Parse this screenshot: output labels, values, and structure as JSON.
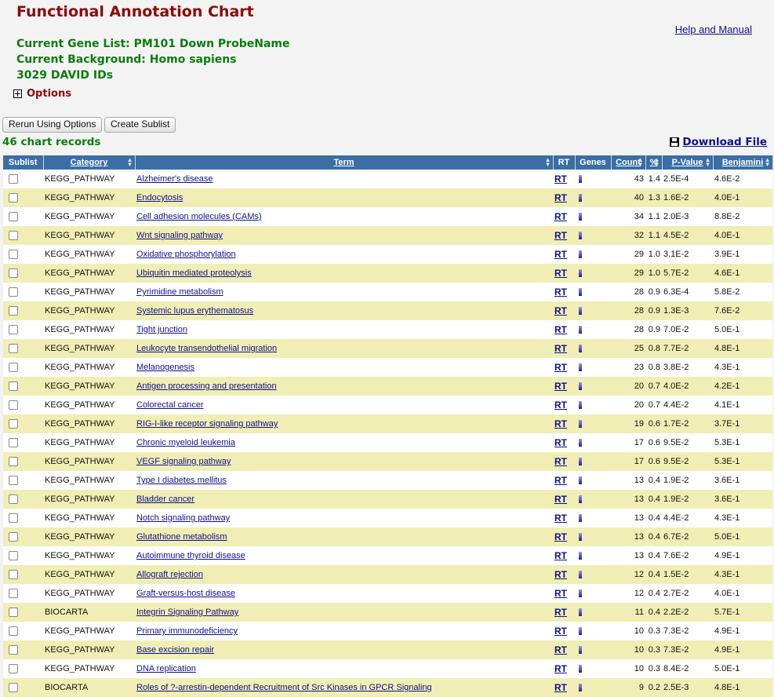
{
  "page": {
    "title": "Functional Annotation Chart",
    "help_link": "Help and Manual",
    "gene_list": "Current Gene List: PM101 Down ProbeName",
    "background": "Current Background: Homo sapiens",
    "david_ids": "3029 DAVID IDs",
    "options_label": "Options",
    "rerun_button": "Rerun Using Options",
    "sublist_button": "Create Sublist",
    "record_count": "46 chart records",
    "download_label": "Download File"
  },
  "table": {
    "headers": {
      "sublist": "Sublist",
      "category": "Category",
      "term": "Term",
      "rt": "RT",
      "genes": "Genes",
      "count": "Count",
      "percent": "%",
      "pvalue": "P-Value",
      "benjamini": "Benjamini"
    },
    "rows": [
      {
        "category": "KEGG_PATHWAY",
        "term": "Alzheimer's disease",
        "rt": "RT",
        "count": "43",
        "percent": "1.4",
        "pvalue": "2.5E-4",
        "benjamini": "4.6E-2"
      },
      {
        "category": "KEGG_PATHWAY",
        "term": "Endocytosis",
        "rt": "RT",
        "count": "40",
        "percent": "1.3",
        "pvalue": "1.6E-2",
        "benjamini": "4.0E-1"
      },
      {
        "category": "KEGG_PATHWAY",
        "term": "Cell adhesion molecules (CAMs)",
        "rt": "RT",
        "count": "34",
        "percent": "1.1",
        "pvalue": "2.0E-3",
        "benjamini": "8.8E-2"
      },
      {
        "category": "KEGG_PATHWAY",
        "term": "Wnt signaling pathway",
        "rt": "RT",
        "count": "32",
        "percent": "1.1",
        "pvalue": "4.5E-2",
        "benjamini": "4.0E-1"
      },
      {
        "category": "KEGG_PATHWAY",
        "term": "Oxidative phosphorylation",
        "rt": "RT",
        "count": "29",
        "percent": "1.0",
        "pvalue": "3.1E-2",
        "benjamini": "3.9E-1"
      },
      {
        "category": "KEGG_PATHWAY",
        "term": "Ubiquitin mediated proteolysis",
        "rt": "RT",
        "count": "29",
        "percent": "1.0",
        "pvalue": "5.7E-2",
        "benjamini": "4.6E-1"
      },
      {
        "category": "KEGG_PATHWAY",
        "term": "Pyrimidine metabolism",
        "rt": "RT",
        "count": "28",
        "percent": "0.9",
        "pvalue": "6.3E-4",
        "benjamini": "5.8E-2"
      },
      {
        "category": "KEGG_PATHWAY",
        "term": "Systemic lupus erythematosus",
        "rt": "RT",
        "count": "28",
        "percent": "0.9",
        "pvalue": "1.3E-3",
        "benjamini": "7.6E-2"
      },
      {
        "category": "KEGG_PATHWAY",
        "term": "Tight junction",
        "rt": "RT",
        "count": "28",
        "percent": "0.9",
        "pvalue": "7.0E-2",
        "benjamini": "5.0E-1"
      },
      {
        "category": "KEGG_PATHWAY",
        "term": "Leukocyte transendothelial migration",
        "rt": "RT",
        "count": "25",
        "percent": "0.8",
        "pvalue": "7.7E-2",
        "benjamini": "4.8E-1"
      },
      {
        "category": "KEGG_PATHWAY",
        "term": "Melanogenesis",
        "rt": "RT",
        "count": "23",
        "percent": "0.8",
        "pvalue": "3.8E-2",
        "benjamini": "4.3E-1"
      },
      {
        "category": "KEGG_PATHWAY",
        "term": "Antigen processing and presentation",
        "rt": "RT",
        "count": "20",
        "percent": "0.7",
        "pvalue": "4.0E-2",
        "benjamini": "4.2E-1"
      },
      {
        "category": "KEGG_PATHWAY",
        "term": "Colorectal cancer",
        "rt": "RT",
        "count": "20",
        "percent": "0.7",
        "pvalue": "4.4E-2",
        "benjamini": "4.1E-1"
      },
      {
        "category": "KEGG_PATHWAY",
        "term": "RIG-I-like receptor signaling pathway",
        "rt": "RT",
        "count": "19",
        "percent": "0.6",
        "pvalue": "1.7E-2",
        "benjamini": "3.7E-1"
      },
      {
        "category": "KEGG_PATHWAY",
        "term": "Chronic myeloid leukemia",
        "rt": "RT",
        "count": "17",
        "percent": "0.6",
        "pvalue": "9.5E-2",
        "benjamini": "5.3E-1"
      },
      {
        "category": "KEGG_PATHWAY",
        "term": "VEGF signaling pathway",
        "rt": "RT",
        "count": "17",
        "percent": "0.6",
        "pvalue": "9.5E-2",
        "benjamini": "5.3E-1"
      },
      {
        "category": "KEGG_PATHWAY",
        "term": "Type I diabetes mellitus",
        "rt": "RT",
        "count": "13",
        "percent": "0.4",
        "pvalue": "1.9E-2",
        "benjamini": "3.6E-1"
      },
      {
        "category": "KEGG_PATHWAY",
        "term": "Bladder cancer",
        "rt": "RT",
        "count": "13",
        "percent": "0.4",
        "pvalue": "1.9E-2",
        "benjamini": "3.6E-1"
      },
      {
        "category": "KEGG_PATHWAY",
        "term": "Notch signaling pathway",
        "rt": "RT",
        "count": "13",
        "percent": "0.4",
        "pvalue": "4.4E-2",
        "benjamini": "4.3E-1"
      },
      {
        "category": "KEGG_PATHWAY",
        "term": "Glutathione metabolism",
        "rt": "RT",
        "count": "13",
        "percent": "0.4",
        "pvalue": "6.7E-2",
        "benjamini": "5.0E-1"
      },
      {
        "category": "KEGG_PATHWAY",
        "term": "Autoimmune thyroid disease",
        "rt": "RT",
        "count": "13",
        "percent": "0.4",
        "pvalue": "7.6E-2",
        "benjamini": "4.9E-1"
      },
      {
        "category": "KEGG_PATHWAY",
        "term": "Allograft rejection",
        "rt": "RT",
        "count": "12",
        "percent": "0.4",
        "pvalue": "1.5E-2",
        "benjamini": "4.3E-1"
      },
      {
        "category": "KEGG_PATHWAY",
        "term": "Graft-versus-host disease",
        "rt": "RT",
        "count": "12",
        "percent": "0.4",
        "pvalue": "2.7E-2",
        "benjamini": "4.0E-1"
      },
      {
        "category": "BIOCARTA",
        "term": "Integrin Signaling Pathway",
        "rt": "RT",
        "count": "11",
        "percent": "0.4",
        "pvalue": "2.2E-2",
        "benjamini": "5.7E-1"
      },
      {
        "category": "KEGG_PATHWAY",
        "term": "Primary immunodeficiency",
        "rt": "RT",
        "count": "10",
        "percent": "0.3",
        "pvalue": "7.3E-2",
        "benjamini": "4.9E-1"
      },
      {
        "category": "KEGG_PATHWAY",
        "term": "Base excision repair",
        "rt": "RT",
        "count": "10",
        "percent": "0.3",
        "pvalue": "7.3E-2",
        "benjamini": "4.9E-1"
      },
      {
        "category": "KEGG_PATHWAY",
        "term": "DNA replication",
        "rt": "RT",
        "count": "10",
        "percent": "0.3",
        "pvalue": "8.4E-2",
        "benjamini": "5.0E-1"
      },
      {
        "category": "BIOCARTA",
        "term": "Roles of ?-arrestin-dependent Recruitment of Src Kinases in GPCR Signaling",
        "rt": "RT",
        "count": "9",
        "percent": "0.2",
        "pvalue": "2.5E-3",
        "benjamini": "4.8E-1"
      }
    ]
  }
}
